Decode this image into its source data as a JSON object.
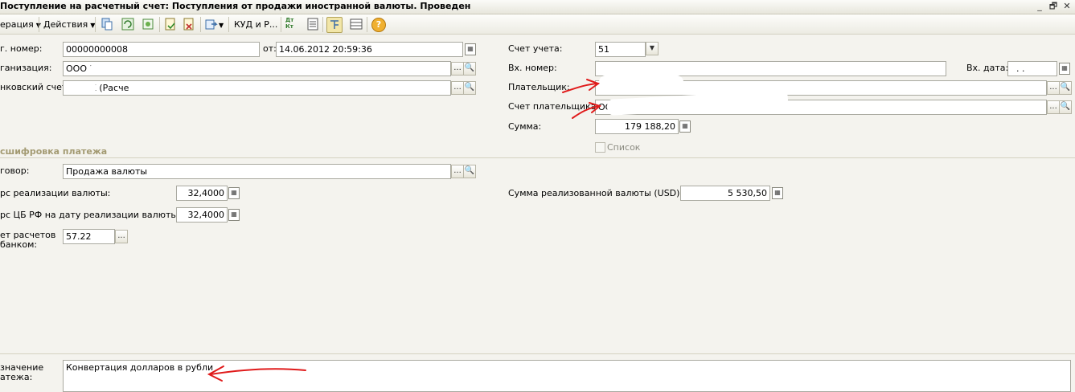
{
  "window": {
    "title": "Поступление на расчетный счет: Поступления от продажи иностранной валюты. Проведен",
    "minimize_glyph": "_",
    "restore_glyph": "🗗",
    "close_glyph": "✕"
  },
  "toolbar": {
    "operation_label": "ерация",
    "actions_label": "Действия",
    "kudir_label": "КУД и Р...",
    "dtkt_label": "Дт Кт",
    "help_glyph": "?"
  },
  "form": {
    "doc_number": {
      "label": "г. номер:",
      "value": "00000000008"
    },
    "date": {
      "label": "от:",
      "value": "14.06.2012 20:59:36"
    },
    "organization": {
      "label": "ганизация:",
      "value": "ООО \""
    },
    "bank_account": {
      "label": "нковский счет:",
      "value": "«БАНК (Расчетный)"
    },
    "account": {
      "label": "Счет учета:",
      "value": "51"
    },
    "incoming_number": {
      "label": "Вх. номер:",
      "value": ""
    },
    "incoming_date": {
      "label": "Вх. дата:",
      "value": ". ."
    },
    "payer": {
      "label": "Плательщик:",
      "value": ""
    },
    "payer_account": {
      "label": "Счет плательщика:",
      "value": "ООО"
    },
    "amount": {
      "label": "Сумма:",
      "value": "179 188,20"
    },
    "list_checkbox": {
      "label": "Список",
      "checked": false
    }
  },
  "payment_section": {
    "title": "сшифровка платежа",
    "contract": {
      "label": "говор:",
      "value": "Продажа валюты"
    },
    "sale_rate": {
      "label": "рс реализации валюты:",
      "value": "32,4000"
    },
    "cb_rate": {
      "label": "рс ЦБ РФ на дату реализации валюты:",
      "value": "32,4000"
    },
    "settlement_account": {
      "label_line1": "ет расчетов",
      "label_line2": "банком:",
      "value": "57.22"
    },
    "sold_amount": {
      "label": "Сумма реализованной валюты (USD):",
      "value": "5 530,50"
    }
  },
  "purpose": {
    "label_line1": "значение",
    "label_line2": "атежа:",
    "value": "Конвертация долларов в рубли"
  },
  "ellipsis": "...",
  "magnifier_glyph": "🔍",
  "dropdown_glyph": "▼",
  "calc_glyph": "▦",
  "colors": {
    "annotation_red": "#e01b1b",
    "section_title": "#a39a72"
  }
}
